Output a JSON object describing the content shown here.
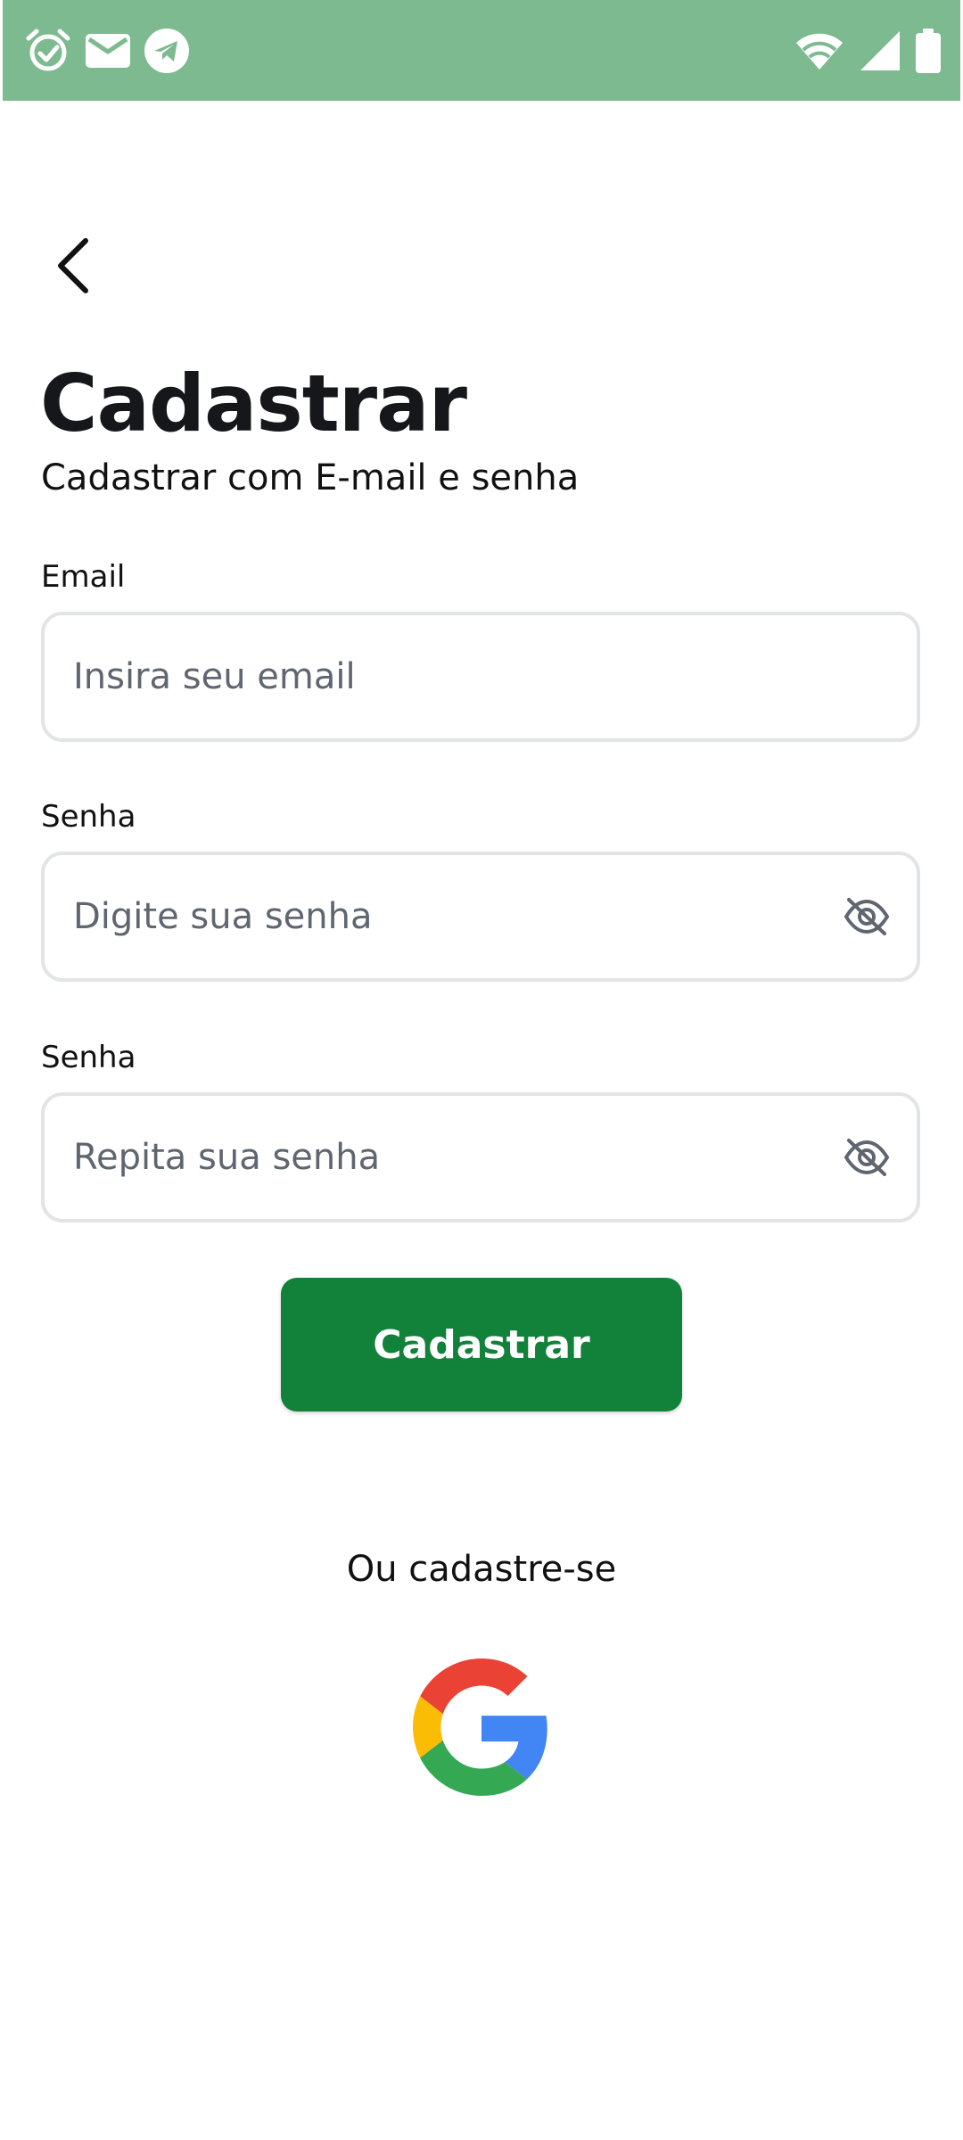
{
  "status_bar": {
    "background": "#7dba8f",
    "left_icons": [
      "alarm-check-icon",
      "mail-icon",
      "telegram-icon"
    ],
    "right_icons": [
      "wifi-icon",
      "cell-signal-icon",
      "battery-icon"
    ]
  },
  "header": {
    "back_icon": "chevron-left-icon"
  },
  "page": {
    "title": "Cadastrar",
    "subtitle": "Cadastrar com E-mail e senha"
  },
  "form": {
    "email": {
      "label": "Email",
      "placeholder": "Insira seu email",
      "value": ""
    },
    "password": {
      "label": "Senha",
      "placeholder": "Digite sua senha",
      "value": "",
      "toggle_icon": "eye-off-icon"
    },
    "confirm_password": {
      "label": "Senha",
      "placeholder": "Repita sua senha",
      "value": "",
      "toggle_icon": "eye-off-icon"
    },
    "submit_label": "Cadastrar"
  },
  "social": {
    "prompt": "Ou cadastre-se",
    "providers": [
      "google-icon"
    ]
  },
  "colors": {
    "primary": "#12813a",
    "status_bar": "#7dba8f",
    "field_border": "#e3e4e7",
    "placeholder": "#5f6670"
  }
}
